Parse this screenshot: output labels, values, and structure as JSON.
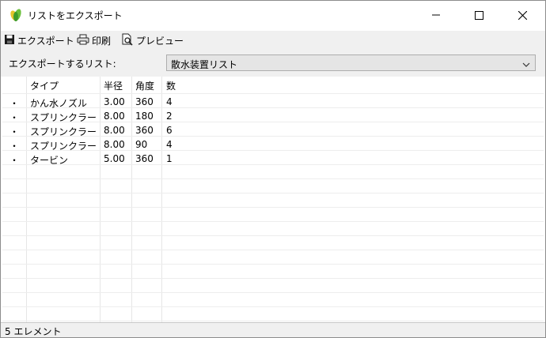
{
  "window": {
    "title": "リストをエクスポート"
  },
  "toolbar": {
    "export_label": "エクスポート",
    "print_label": "印刷",
    "preview_label": "プレビュー"
  },
  "list_selector": {
    "label": "エクスポートするリスト:",
    "selected": "散水装置リスト"
  },
  "table": {
    "columns": [
      "タイプ",
      "半径",
      "角度",
      "数"
    ],
    "rows": [
      {
        "bullet": "・",
        "type": "かん水ノズル",
        "radius": "3.00",
        "angle": "360",
        "count": "4"
      },
      {
        "bullet": "・",
        "type": "スプリンクラー",
        "radius": "8.00",
        "angle": "180",
        "count": "2"
      },
      {
        "bullet": "・",
        "type": "スプリンクラー",
        "radius": "8.00",
        "angle": "360",
        "count": "6"
      },
      {
        "bullet": "・",
        "type": "スプリンクラー",
        "radius": "8.00",
        "angle": "90",
        "count": "4"
      },
      {
        "bullet": "・",
        "type": "タービン",
        "radius": "5.00",
        "angle": "360",
        "count": "1"
      }
    ]
  },
  "status": {
    "text": "5 エレメント"
  },
  "icons": {
    "app": "leaf-app-icon",
    "export": "save-icon",
    "print": "printer-icon",
    "preview": "print-preview-icon",
    "minimize": "minimize-icon",
    "maximize": "maximize-icon",
    "close": "close-icon",
    "dropdown": "chevron-down-icon"
  },
  "colors": {
    "leaf_green": "#6abf3a",
    "leaf_yellow": "#e3c52a",
    "toolbar_bg": "#f0f0f0"
  }
}
